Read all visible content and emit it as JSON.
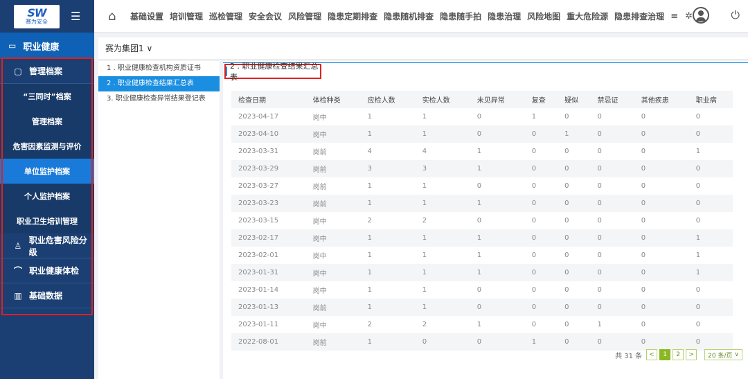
{
  "logo": {
    "brand": "SW",
    "name": "赛为安全"
  },
  "sidebar": {
    "title": "职业健康",
    "groups": [
      {
        "label": "管理档案"
      },
      {
        "label": "职业危害风险分级"
      },
      {
        "label": "职业健康体检"
      },
      {
        "label": "基础数据"
      }
    ],
    "sub_items": [
      {
        "label": "“三同时”档案"
      },
      {
        "label": "管理档案"
      },
      {
        "label": "危害因素监测与评价"
      },
      {
        "label": "单位监护档案"
      },
      {
        "label": "个人监护档案"
      },
      {
        "label": "职业卫生培训管理"
      }
    ]
  },
  "topnav": {
    "items": [
      "基础设置",
      "培训管理",
      "巡检管理",
      "安全会议",
      "风险管理",
      "隐患定期排查",
      "隐患随机排查",
      "隐患随手拍",
      "隐患治理",
      "风险地图",
      "重大危险源",
      "隐患排查治理"
    ]
  },
  "org": {
    "selected": "赛为集团1"
  },
  "reports": [
    {
      "label": "1 . 职业健康检查机构资质证书"
    },
    {
      "label": "2 . 职业健康检查结果汇总表"
    },
    {
      "label": "3. 职业健康检查异常结果登记表"
    }
  ],
  "main": {
    "heading": "2 . 职业健康检查结果汇总表"
  },
  "table": {
    "columns": [
      "检查日期",
      "体检种类",
      "应检人数",
      "实检人数",
      "未见异常",
      "复查",
      "疑似",
      "禁忌证",
      "其他疾患",
      "职业病"
    ],
    "rows": [
      [
        "2023-04-17",
        "岗中",
        "1",
        "1",
        "0",
        "1",
        "0",
        "0",
        "0",
        "0"
      ],
      [
        "2023-04-10",
        "岗中",
        "1",
        "1",
        "0",
        "0",
        "1",
        "0",
        "0",
        "0"
      ],
      [
        "2023-03-31",
        "岗前",
        "4",
        "4",
        "1",
        "0",
        "0",
        "0",
        "0",
        "1"
      ],
      [
        "2023-03-29",
        "岗前",
        "3",
        "3",
        "1",
        "0",
        "0",
        "0",
        "0",
        "0"
      ],
      [
        "2023-03-27",
        "岗前",
        "1",
        "1",
        "0",
        "0",
        "0",
        "0",
        "0",
        "0"
      ],
      [
        "2023-03-23",
        "岗前",
        "1",
        "1",
        "1",
        "0",
        "0",
        "0",
        "0",
        "0"
      ],
      [
        "2023-03-15",
        "岗中",
        "2",
        "2",
        "0",
        "0",
        "0",
        "0",
        "0",
        "0"
      ],
      [
        "2023-02-17",
        "岗中",
        "1",
        "1",
        "1",
        "0",
        "0",
        "0",
        "0",
        "1"
      ],
      [
        "2023-02-01",
        "岗中",
        "1",
        "1",
        "1",
        "0",
        "0",
        "0",
        "0",
        "1"
      ],
      [
        "2023-01-31",
        "岗中",
        "1",
        "1",
        "1",
        "0",
        "0",
        "0",
        "0",
        "1"
      ],
      [
        "2023-01-14",
        "岗中",
        "1",
        "1",
        "0",
        "0",
        "0",
        "0",
        "0",
        "0"
      ],
      [
        "2023-01-13",
        "岗前",
        "1",
        "1",
        "0",
        "0",
        "0",
        "0",
        "0",
        "0"
      ],
      [
        "2023-01-11",
        "岗中",
        "2",
        "2",
        "1",
        "0",
        "0",
        "1",
        "0",
        "0"
      ],
      [
        "2022-08-01",
        "岗前",
        "1",
        "0",
        "0",
        "1",
        "0",
        "0",
        "0",
        "0"
      ]
    ]
  },
  "pager": {
    "total": "共 31 条",
    "pages": [
      "1",
      "2"
    ],
    "current": "1",
    "size": "20 条/页",
    "prev": "<",
    "next": ">"
  },
  "icons": {
    "menu": "menu-icon",
    "home": "home-icon",
    "more": "more-icon",
    "gear": "gear-icon",
    "user": "user-icon",
    "power": "power-icon"
  },
  "colors": {
    "sidebar": "#1b3f72",
    "active": "#1a7ad9",
    "highlight_frame": "#e02020",
    "pager_accent": "#8ab822"
  }
}
